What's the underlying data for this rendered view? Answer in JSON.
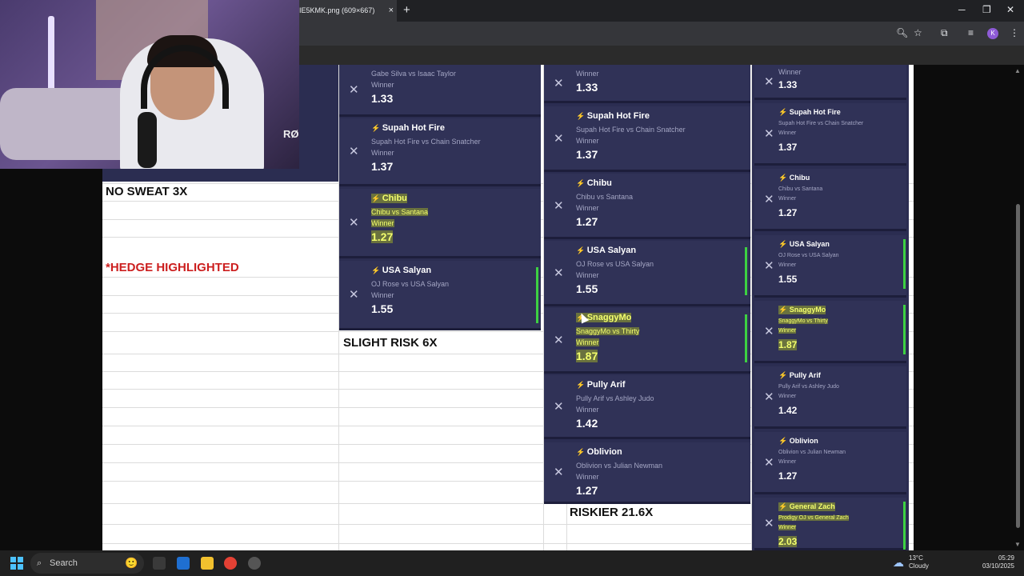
{
  "browser": {
    "tab_title": "IE5KMK.png (609×667)",
    "tab_close": "×",
    "new_tab": "+",
    "window_minimize": "─",
    "window_restore": "❐",
    "window_close": "✕",
    "profile_initial": "K"
  },
  "stream": {
    "logo_text": "RØ"
  },
  "sheet": {
    "labels": {
      "no_sweat": "NO SWEAT 3X",
      "hedge": "*HEDGE HIGHLIGHTED",
      "slight_risk": "SLIGHT RISK 6X",
      "riskier": "RISKIER 21.6X"
    }
  },
  "slip_a": [
    {
      "title": "",
      "match": "Gabe Silva vs Isaac Taylor",
      "market": "Winner",
      "odds": "1.33",
      "highlight": false
    },
    {
      "title": "Supah Hot Fire",
      "match": "Supah Hot Fire vs Chain Snatcher",
      "market": "Winner",
      "odds": "1.37",
      "highlight": false
    },
    {
      "title": "Chibu",
      "match": "Chibu vs Santana",
      "market": "Winner",
      "odds": "1.27",
      "highlight": true
    },
    {
      "title": "USA Salyan",
      "match": "OJ Rose vs USA Salyan",
      "market": "Winner",
      "odds": "1.55",
      "highlight": false
    }
  ],
  "slip_b": [
    {
      "title": "",
      "match": "",
      "market": "Winner",
      "odds": "1.33",
      "highlight": false
    },
    {
      "title": "Supah Hot Fire",
      "match": "Supah Hot Fire vs Chain Snatcher",
      "market": "Winner",
      "odds": "1.37",
      "highlight": false
    },
    {
      "title": "Chibu",
      "match": "Chibu vs Santana",
      "market": "Winner",
      "odds": "1.27",
      "highlight": false
    },
    {
      "title": "USA Salyan",
      "match": "OJ Rose vs USA Salyan",
      "market": "Winner",
      "odds": "1.55",
      "highlight": false
    },
    {
      "title": "SnaggyMo",
      "match": "SnaggyMo vs Thirty",
      "market": "Winner",
      "odds": "1.87",
      "highlight": true
    },
    {
      "title": "Pully Arif",
      "match": "Pully Arif vs Ashley Judo",
      "market": "Winner",
      "odds": "1.42",
      "highlight": false
    },
    {
      "title": "Oblivion",
      "match": "Oblivion vs Julian Newman",
      "market": "Winner",
      "odds": "1.27",
      "highlight": false
    }
  ],
  "slip_c": [
    {
      "title": "",
      "match": "",
      "market": "Winner",
      "odds": "1.33",
      "highlight": false
    },
    {
      "title": "Supah Hot Fire",
      "match": "Supah Hot Fire vs Chain Snatcher",
      "market": "Winner",
      "odds": "1.37",
      "highlight": false
    },
    {
      "title": "Chibu",
      "match": "Chibu vs Santana",
      "market": "Winner",
      "odds": "1.27",
      "highlight": false
    },
    {
      "title": "USA Salyan",
      "match": "OJ Rose vs USA Salyan",
      "market": "Winner",
      "odds": "1.55",
      "highlight": false
    },
    {
      "title": "SnaggyMo",
      "match": "SnaggyMo vs Thirty",
      "market": "Winner",
      "odds": "1.87",
      "highlight": true
    },
    {
      "title": "Pully Arif",
      "match": "Pully Arif vs Ashley Judo",
      "market": "Winner",
      "odds": "1.42",
      "highlight": false
    },
    {
      "title": "Oblivion",
      "match": "Oblivion vs Julian Newman",
      "market": "Winner",
      "odds": "1.27",
      "highlight": false
    },
    {
      "title": "General Zach",
      "match": "Prodigy OJ vs General Zach",
      "market": "Winner",
      "odds": "2.03",
      "highlight": true
    }
  ],
  "taskbar": {
    "search_placeholder": "Search",
    "weather_temp": "13°C",
    "weather_desc": "Cloudy",
    "time": "05:29",
    "date": "03/10/2025"
  },
  "colors": {
    "card_bg": "#303257",
    "highlight": "#e8ff1a",
    "hedge_red": "#cc1f1f",
    "active_bar": "#3dd142"
  }
}
